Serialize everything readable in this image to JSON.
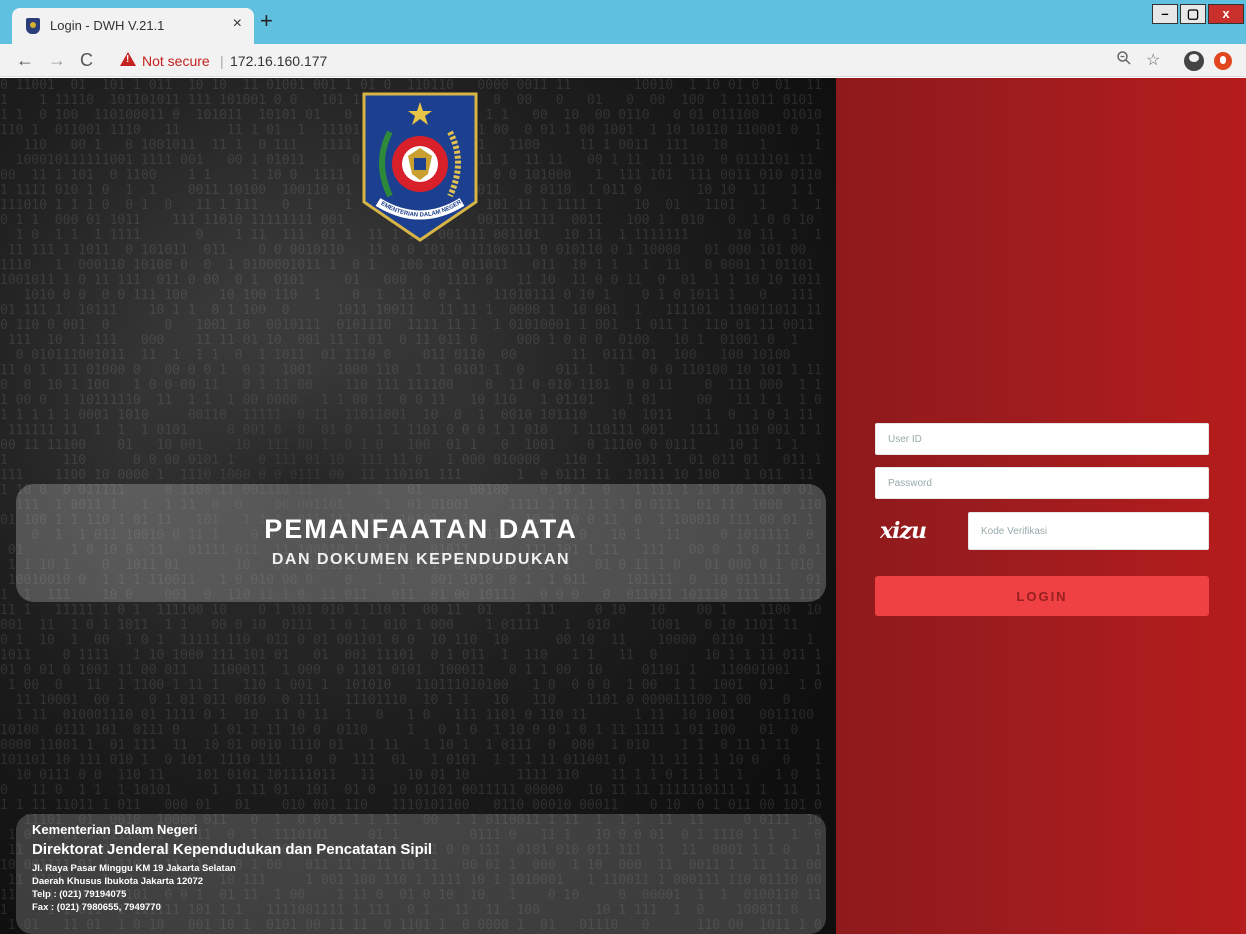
{
  "browser": {
    "tab_title": "Login - DWH V.21.1",
    "tab_close": "×",
    "new_tab": "+",
    "not_secure": "Not secure",
    "separator": "|",
    "url": "172.16.160.177",
    "window_min": "–",
    "window_max": "▢",
    "window_close": "x",
    "nav_back": "←",
    "nav_forward": "→",
    "nav_reload": "C"
  },
  "banner": {
    "title": "PEMANFAATAN DATA",
    "subtitle": "DAN DOKUMEN KEPENDUDUKAN"
  },
  "emblem": {
    "ribbon_text": "KEMENTERIAN DALAM NEGERI"
  },
  "footer": {
    "line1": "Kementerian Dalam Negeri",
    "line2": "Direktorat Jenderal Kependudukan dan Pencatatan Sipil",
    "line3": "Jl. Raya Pasar Minggu KM 19 Jakarta Selatan",
    "line4": "Daerah Khusus Ibukota Jakarta 12072",
    "line5": "Telp : (021) 79194075",
    "line6": "Fax : (021) 7980655, 7949770"
  },
  "login_form": {
    "userid_placeholder": "User ID",
    "password_placeholder": "Password",
    "captcha_text": "xizu",
    "verification_placeholder": "Kode Verifikasi",
    "login_label": "LOGIN"
  },
  "colors": {
    "chrome_titlebar": "#5fc0e0",
    "right_panel": "#a01c1e",
    "login_button": "#ef4043"
  }
}
